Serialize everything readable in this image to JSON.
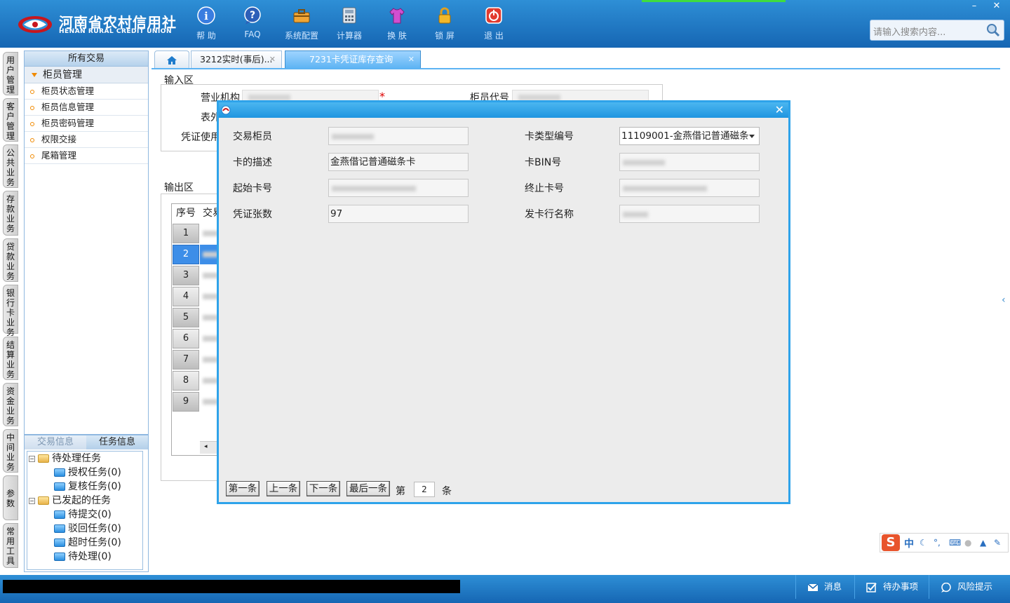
{
  "brand": {
    "name_cn": "河南省农村信用社",
    "name_en": "HENAN RURAL CREDIT UNION",
    "colors": {
      "header": "#1f7ccc",
      "accent": "#2ea3ea",
      "required": "#dd0000"
    }
  },
  "toolbar": [
    {
      "label": "帮 助",
      "icon": "info-icon"
    },
    {
      "label": "FAQ",
      "icon": "question-icon"
    },
    {
      "label": "系统配置",
      "icon": "toolbox-icon"
    },
    {
      "label": "计算器",
      "icon": "calculator-icon"
    },
    {
      "label": "换 肤",
      "icon": "shirt-icon"
    },
    {
      "label": "锁 屏",
      "icon": "lock-icon"
    },
    {
      "label": "退 出",
      "icon": "power-icon"
    }
  ],
  "window_controls": {
    "minimize": "–",
    "close": "✕"
  },
  "search": {
    "placeholder": "请输入搜索内容..."
  },
  "vnav": [
    "用户管理",
    "客户管理",
    "公共业务",
    "存款业务",
    "贷款业务",
    "银行卡业务",
    "结算业务",
    "资金业务",
    "中间业务",
    "参数",
    "常用工具"
  ],
  "left_panel": {
    "header": "所有交易",
    "group": "柜员管理",
    "items": [
      "柜员状态管理",
      "柜员信息管理",
      "柜员密码管理",
      "权限交接",
      "尾箱管理"
    ]
  },
  "task_panel": {
    "tabs": [
      "交易信息",
      "任务信息"
    ],
    "tree": [
      {
        "label": "待处理任务",
        "level": 0
      },
      {
        "label": "授权任务(0)",
        "level": 1
      },
      {
        "label": "复核任务(0)",
        "level": 1
      },
      {
        "label": "已发起的任务",
        "level": 0
      },
      {
        "label": "待提交(0)",
        "level": 1
      },
      {
        "label": "驳回任务(0)",
        "level": 1
      },
      {
        "label": "超时任务(0)",
        "level": 1
      },
      {
        "label": "待处理(0)",
        "level": 1
      }
    ]
  },
  "tabs": [
    {
      "label": "3212实时(事后)..."
    },
    {
      "label": "7231卡凭证库存查询",
      "active": true
    }
  ],
  "form": {
    "input_section": "输入区",
    "output_section": "输出区",
    "labels": {
      "org": "营业机构",
      "teller_code": "柜员代号",
      "table_ext": "表外",
      "voucher_use": "凭证使用"
    },
    "grid_headers": {
      "seq": "序号",
      "trade": "交易"
    },
    "rows": [
      "1",
      "2",
      "3",
      "4",
      "5",
      "6",
      "7",
      "8",
      "9"
    ],
    "selected_row": 2
  },
  "dialog": {
    "fields": {
      "trade_teller": "交易柜员",
      "card_type_code": "卡类型编号",
      "card_desc": "卡的描述",
      "card_bin": "卡BIN号",
      "start_card": "起始卡号",
      "end_card": "终止卡号",
      "voucher_count": "凭证张数",
      "issuer_name": "发卡行名称"
    },
    "values": {
      "card_type_code": "11109001-金燕借记普通磁条",
      "card_desc": "金燕借记普通磁条卡",
      "voucher_count": "97"
    },
    "pager": {
      "first": "第一条",
      "prev": "上一条",
      "next": "下一条",
      "last": "最后一条",
      "prefix": "第",
      "page": "2",
      "suffix": "条"
    }
  },
  "statusbar": [
    {
      "label": "消息",
      "icon": "mail-icon"
    },
    {
      "label": "待办事项",
      "icon": "checkbox-icon"
    },
    {
      "label": "风险提示",
      "icon": "chat-icon"
    }
  ],
  "ime": {
    "logo": "S",
    "mode": "中"
  }
}
